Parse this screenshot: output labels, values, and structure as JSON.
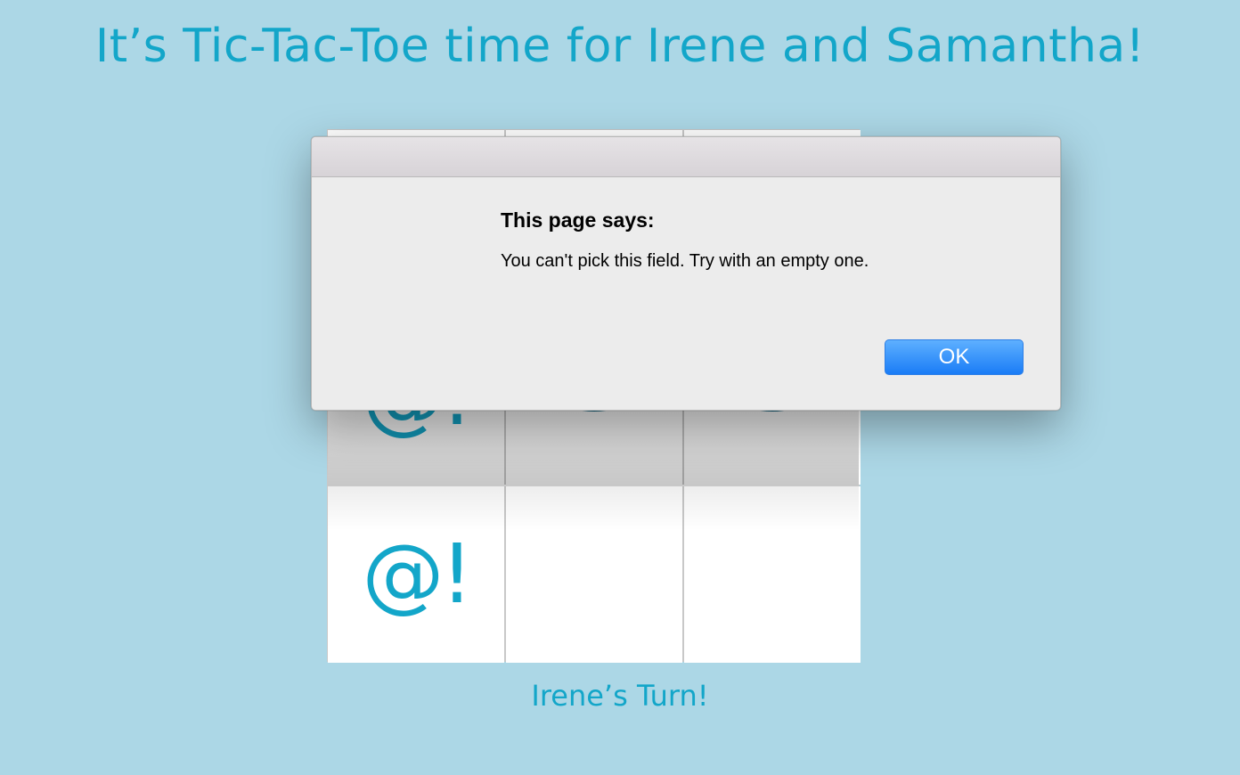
{
  "page": {
    "title": "It’s Tic-Tac-Toe time for Irene and Samantha!",
    "turn": "Irene’s Turn!"
  },
  "board": {
    "cells": [
      {
        "mark": "",
        "icon": "hidden"
      },
      {
        "mark": "",
        "icon": "hidden"
      },
      {
        "mark": "",
        "icon": "hidden"
      },
      {
        "mark": "@!",
        "icon": "at-exclamation"
      },
      {
        "mark": "",
        "icon": "crown-icon"
      },
      {
        "mark": "",
        "icon": "crown-icon"
      },
      {
        "mark": "@!",
        "icon": "at-exclamation"
      },
      {
        "mark": "",
        "icon": "empty"
      },
      {
        "mark": "",
        "icon": "empty"
      }
    ]
  },
  "dialog": {
    "heading": "This page says:",
    "message": "You can't pick this field. Try with an empty one.",
    "ok_label": "OK"
  },
  "colors": {
    "background": "#acd7e6",
    "accent": "#13a6c9",
    "crown": "#1a6f8c",
    "button": "#1a7cf6"
  }
}
